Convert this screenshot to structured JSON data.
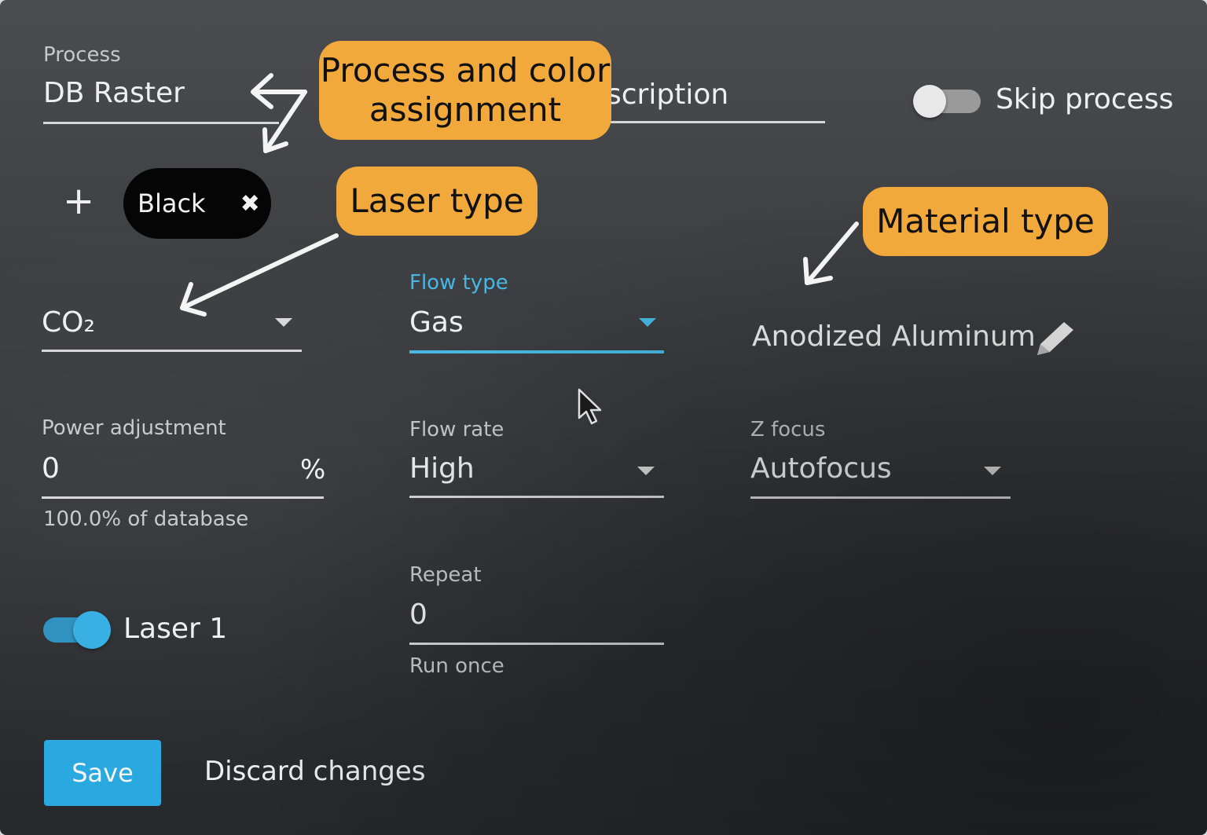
{
  "process": {
    "label": "Process",
    "value": "DB Raster"
  },
  "description": {
    "partial_text": "scription"
  },
  "skip_process": {
    "label": "Skip process",
    "on": false
  },
  "colors": {
    "assigned": [
      {
        "name": "Black"
      }
    ]
  },
  "laser": {
    "type": "CO₂"
  },
  "flow_type": {
    "label": "Flow type",
    "value": "Gas",
    "accent": "#46b8e4"
  },
  "material": {
    "value": "Anodized Aluminum"
  },
  "power": {
    "label": "Power adjustment",
    "value": "0",
    "unit": "%",
    "helper": "100.0% of database"
  },
  "flow_rate": {
    "label": "Flow rate",
    "value": "High"
  },
  "z_focus": {
    "label": "Z focus",
    "value": "Autofocus"
  },
  "repeat": {
    "label": "Repeat",
    "value": "0",
    "helper": "Run once"
  },
  "laser_toggle": {
    "label": "Laser 1",
    "on": true
  },
  "actions": {
    "save_label": "Save",
    "discard_label": "Discard changes"
  },
  "callouts": {
    "process_color": "Process and color assignment",
    "laser_type": "Laser type",
    "material_type": "Material type"
  },
  "colors_theme": {
    "callout": "#f2a93b",
    "primary": "#2aa8e0"
  }
}
